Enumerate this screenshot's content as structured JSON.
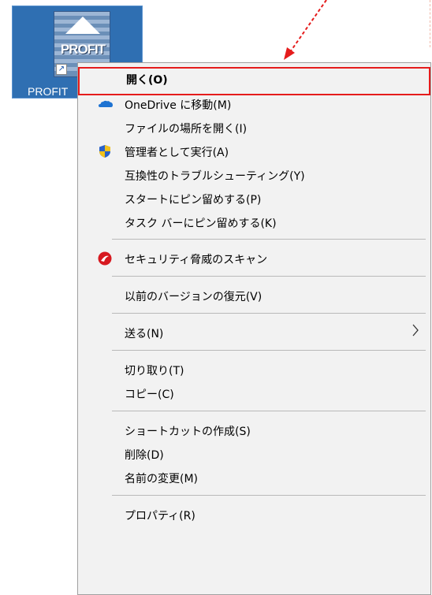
{
  "desktop_icon": {
    "label": "PROFIT",
    "image_text": "PROFIT"
  },
  "menu": {
    "items": [
      {
        "label": "開く(O)",
        "icon": ""
      },
      {
        "label": "OneDrive に移動(M)",
        "icon": "onedrive-cloud-icon"
      },
      {
        "label": "ファイルの場所を開く(I)",
        "icon": ""
      },
      {
        "label": "管理者として実行(A)",
        "icon": "uac-shield-icon"
      },
      {
        "label": "互換性のトラブルシューティング(Y)",
        "icon": ""
      },
      {
        "label": "スタートにピン留めする(P)",
        "icon": ""
      },
      {
        "label": "タスク バーにピン留めする(K)",
        "icon": ""
      },
      {
        "label": "セキュリティ脅威のスキャン",
        "icon": "trend-micro-icon"
      },
      {
        "label": "以前のバージョンの復元(V)",
        "icon": ""
      },
      {
        "label": "送る(N)",
        "icon": "chevron-right-icon"
      },
      {
        "label": "切り取り(T)",
        "icon": ""
      },
      {
        "label": "コピー(C)",
        "icon": ""
      },
      {
        "label": "ショートカットの作成(S)",
        "icon": ""
      },
      {
        "label": "削除(D)",
        "icon": ""
      },
      {
        "label": "名前の変更(M)",
        "icon": ""
      },
      {
        "label": "プロパティ(R)",
        "icon": ""
      }
    ]
  },
  "colors": {
    "highlight": "#e51c1c",
    "menu_bg": "#f2f2f2",
    "icon_bg": "#2f6fb2"
  }
}
